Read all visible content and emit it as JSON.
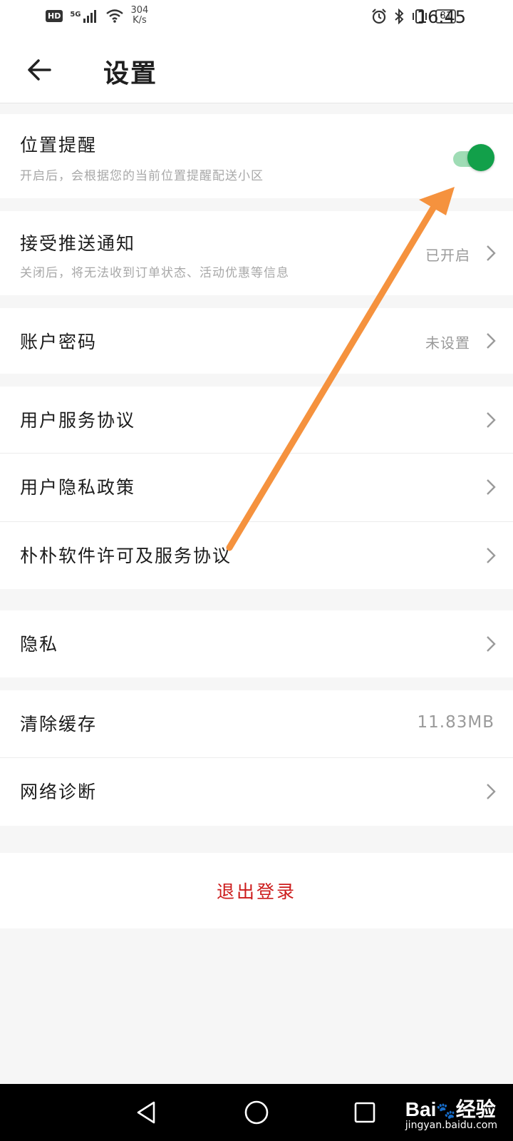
{
  "status_bar": {
    "hd_badge": "HD",
    "network_type": "5G",
    "speed_value": "304",
    "speed_unit": "K/s",
    "battery_level": "81",
    "time": "16:45"
  },
  "app_bar": {
    "title": "设置"
  },
  "settings": {
    "location_reminder": {
      "title": "位置提醒",
      "subtitle": "开启后，会根据您的当前位置提醒配送小区",
      "enabled": true
    },
    "push_notifications": {
      "title": "接受推送通知",
      "subtitle": "关闭后，将无法收到订单状态、活动优惠等信息",
      "value": "已开启"
    },
    "account_password": {
      "title": "账户密码",
      "value": "未设置"
    },
    "user_service_agreement": {
      "title": "用户服务协议"
    },
    "user_privacy_policy": {
      "title": "用户隐私政策"
    },
    "software_license": {
      "title": "朴朴软件许可及服务协议"
    },
    "privacy": {
      "title": "隐私"
    },
    "clear_cache": {
      "title": "清除缓存",
      "value": "11.83MB"
    },
    "network_diagnosis": {
      "title": "网络诊断"
    }
  },
  "logout": {
    "label": "退出登录"
  },
  "watermark": {
    "brand": "Bai",
    "brand_suffix": "经验",
    "url": "jingyan.baidu.com"
  },
  "colors": {
    "toggle_on": "#12a04a",
    "logout_text": "#cc1b1b",
    "annotation_arrow": "#f5923e"
  }
}
